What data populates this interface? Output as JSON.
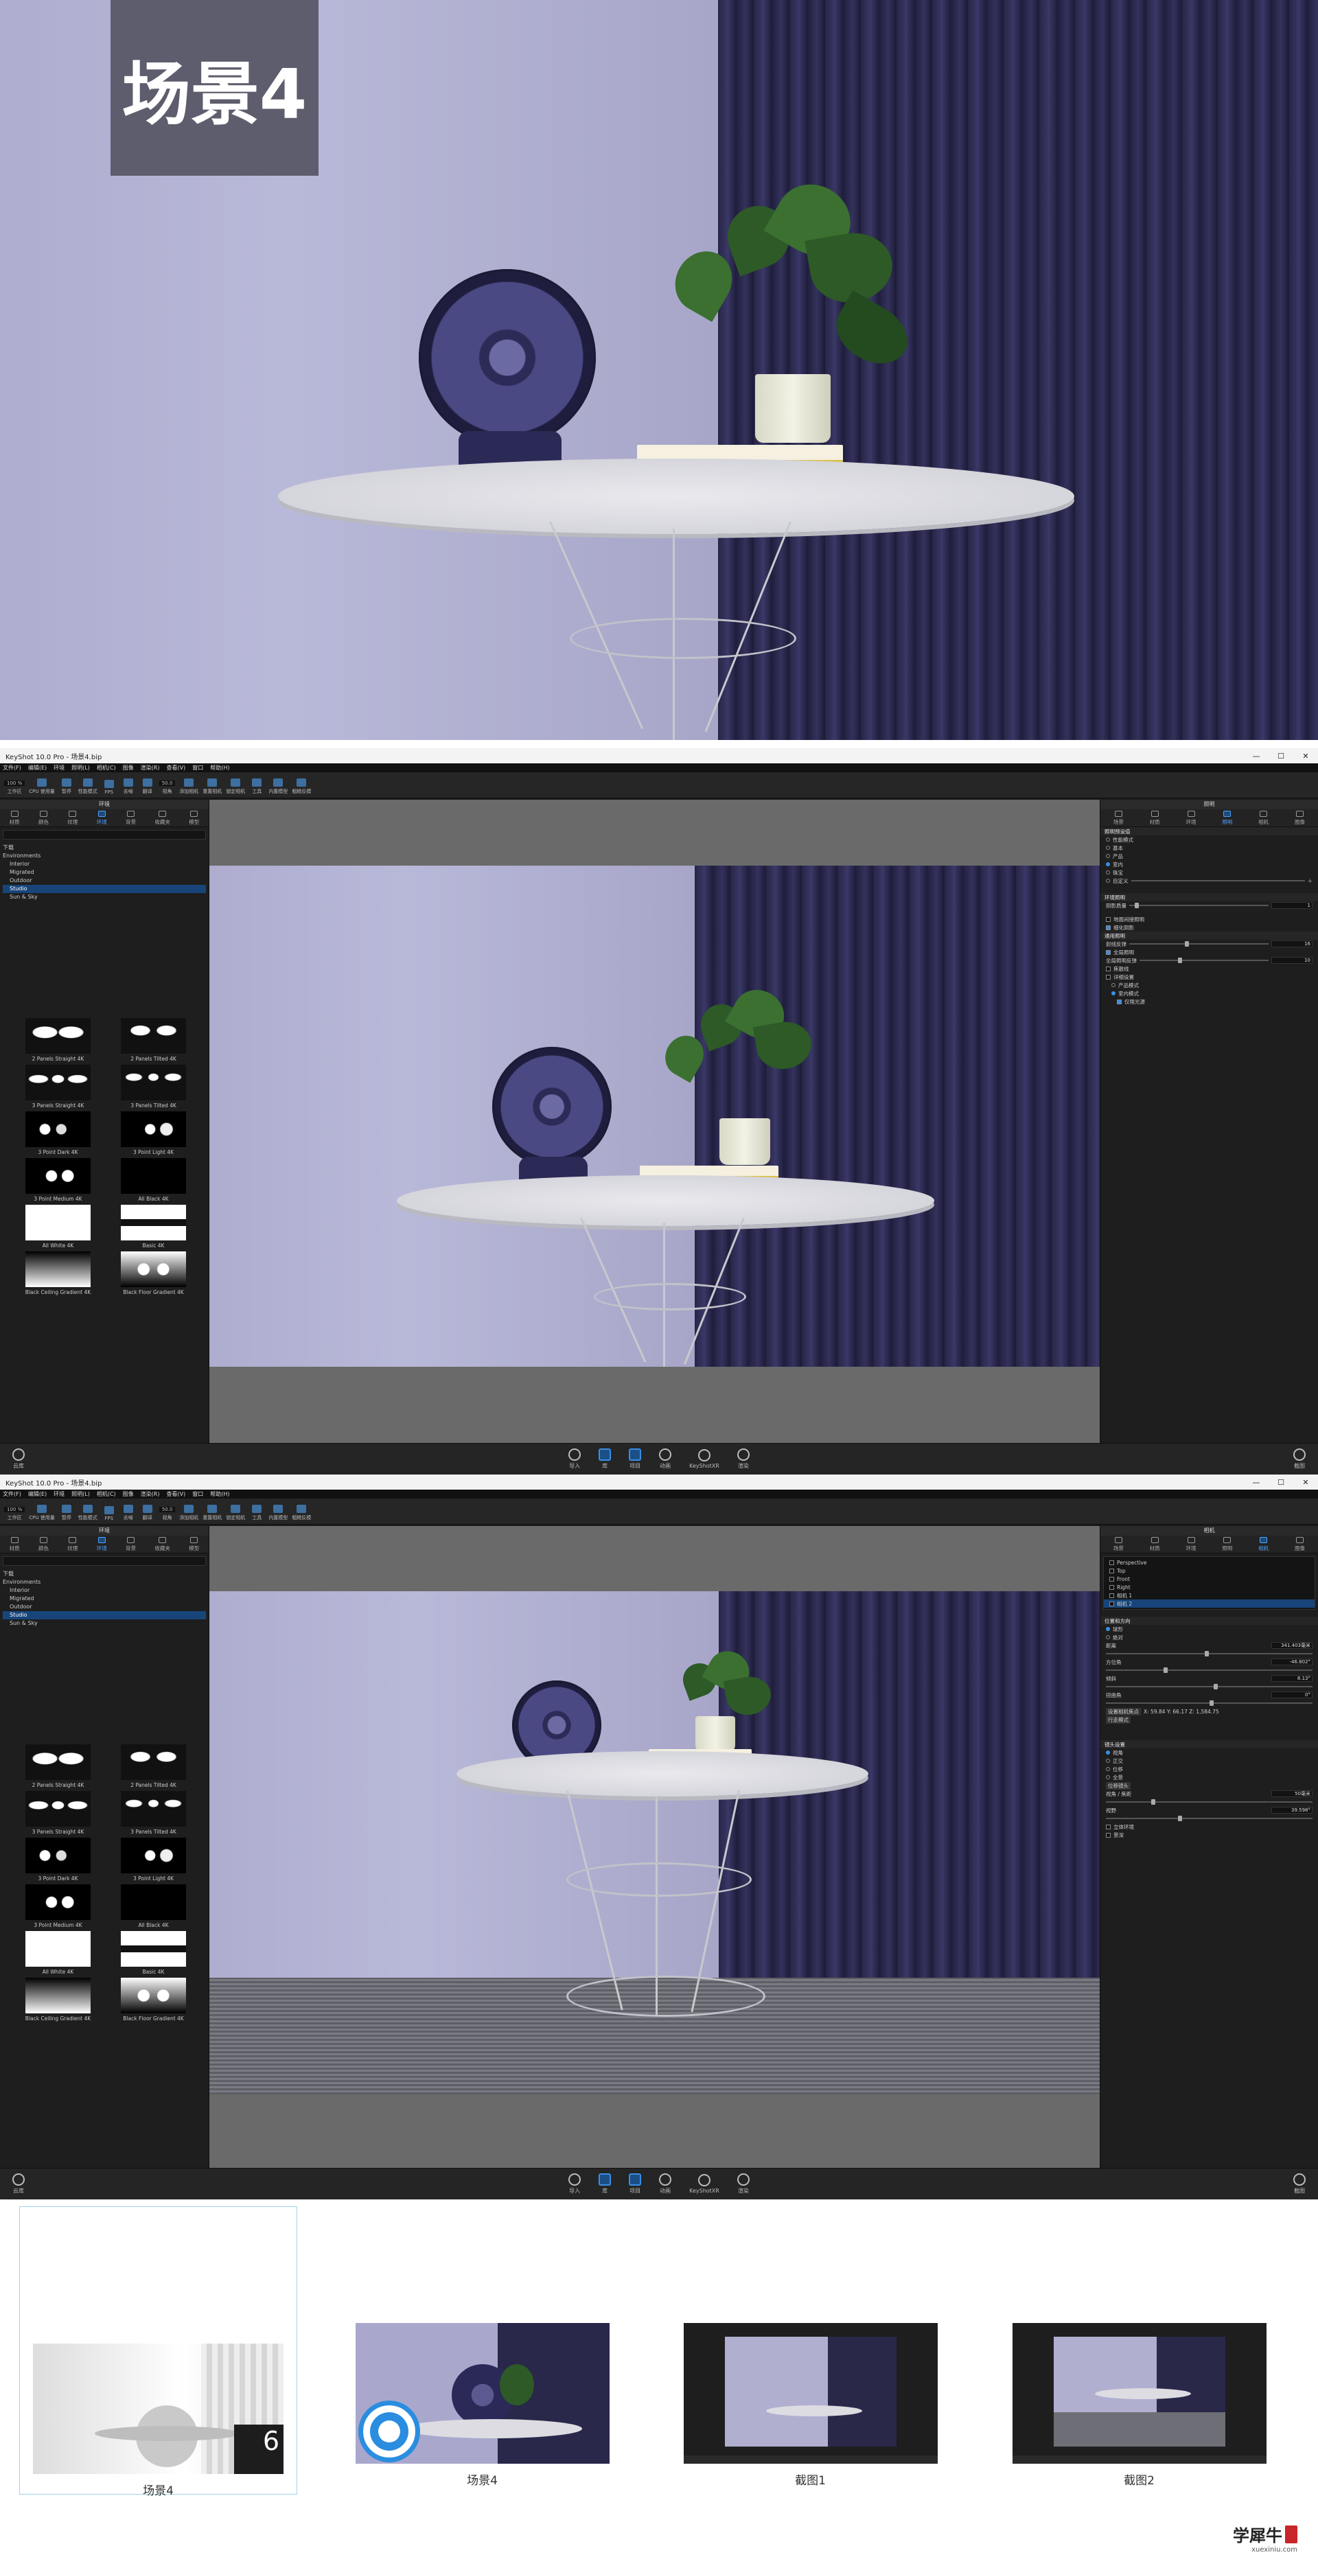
{
  "hero": {
    "badge": "场景4"
  },
  "keyshot": {
    "title": "KeyShot 10.0 Pro  -  场景4.bip",
    "window_controls": [
      "—",
      "☐",
      "✕"
    ],
    "menu": [
      "文件(F)",
      "编辑(E)",
      "环境",
      "照明(L)",
      "相机(C)",
      "图像",
      "渲染(R)",
      "查看(V)",
      "窗口",
      "帮助(H)"
    ],
    "toolbar": {
      "quality_label": "100 %",
      "items": [
        "工作区",
        "CPU 使用量",
        "暂停",
        "性能模式",
        "FPS",
        "去噪",
        "翻译",
        "视角",
        "添加相机",
        "重置相机",
        "锁定相机",
        "工具",
        "内置模型",
        "相机前",
        "相机前组",
        "粗糙反模"
      ],
      "zoom": "50.0"
    },
    "left_panel": {
      "header": "环境",
      "tabs": [
        "材质",
        "颜色",
        "纹理",
        "环境",
        "背景",
        "收藏夹",
        "模型"
      ],
      "active_tab": "环境",
      "tree_root": "下载",
      "tree": [
        "Environments",
        "Interior",
        "Migrated",
        "Outdoor",
        "Studio",
        "Sun & Sky"
      ],
      "selected": "Studio",
      "thumbnails": [
        "2 Panels Straight 4K",
        "2 Panels Tilted 4K",
        "3 Panels Straight 4K",
        "3 Panels Tilted 4K",
        "3 Point Dark 4K",
        "3 Point Light 4K",
        "3 Point Medium 4K",
        "All Black 4K",
        "All White 4K",
        "Basic 4K",
        "Black Ceiling Gradient 4K",
        "Black Floor Gradient 4K"
      ]
    },
    "bottom_bar": [
      "导入",
      "库",
      "项目",
      "动画",
      "KeyShotXR",
      "渲染"
    ],
    "bottom_left": "云库",
    "bottom_right": "截图",
    "right_panel_1": {
      "header": "照明",
      "tabs": [
        "场景",
        "材质",
        "环境",
        "照明",
        "相机",
        "图像"
      ],
      "active_tab": "照明",
      "section1": "照明预设值",
      "presets": [
        "性能模式",
        "基本",
        "产品",
        "室内",
        "珠宝",
        "自定义"
      ],
      "preset_selected": "室内",
      "section2": "环境照明",
      "env_label": "阴影质量",
      "env_value": "1",
      "section3": "通用照明",
      "rows": [
        "射线反弹",
        "全局照明",
        "全局照明反弹"
      ],
      "row_values": [
        "16",
        "",
        "10"
      ],
      "checks": [
        "地面间接照明",
        "细化阴影",
        "焦散线",
        "室内模式",
        "产品模式",
        "室内模式",
        "仅限光源"
      ],
      "detail_label": "详细设置"
    },
    "right_panel_2": {
      "header": "相机",
      "tabs": [
        "场景",
        "材质",
        "环境",
        "照明",
        "相机",
        "图像"
      ],
      "active_tab": "相机",
      "cameras": [
        "Perspective",
        "Top",
        "Front",
        "Right",
        "相机 1",
        "相机 2"
      ],
      "selected_camera": "相机 2",
      "section1": "位置和方向",
      "mode": [
        "球形",
        "绝对"
      ],
      "fields": [
        {
          "label": "距离",
          "value": "341.403毫米"
        },
        {
          "label": "方位角",
          "value": "-46.802°"
        },
        {
          "label": "倾斜",
          "value": "8.13°"
        },
        {
          "label": "扭曲角",
          "value": "0°"
        }
      ],
      "lookat": "设置相机焦点",
      "lookat_value": "X: 59.84  Y: 66.17  Z: 1,584.75",
      "walk_mode": "行走模式",
      "section2": "镜头设置",
      "lens": [
        "视角",
        "正交",
        "位移",
        "全景"
      ],
      "lens_selected": "视角",
      "shift": "位移镜头",
      "fov_label": "视角 / 焦距",
      "fov_value": "50毫米",
      "fov2_label": "视野",
      "fov2_value": "39.598°",
      "section3": "景深",
      "stereo": "立体环境"
    }
  },
  "gallery": [
    {
      "caption": "场景4",
      "badge": "6"
    },
    {
      "caption": "场景4"
    },
    {
      "caption": "截图1"
    },
    {
      "caption": "截图2"
    }
  ],
  "watermark": {
    "brand": "学犀牛",
    "sub": "xuexiniu.com"
  }
}
